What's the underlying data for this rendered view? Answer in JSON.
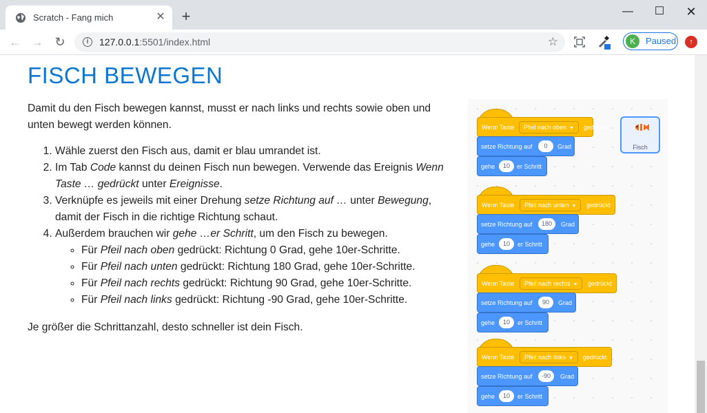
{
  "browser": {
    "tab_title": "Scratch - Fang mich",
    "url_host": "127.0.0.1",
    "url_rest": ":5501/index.html",
    "profile_initial": "K",
    "profile_label": "Paused"
  },
  "page": {
    "title": "FISCH BEWEGEN",
    "intro": "Damit du den Fisch bewegen kannst, musst er nach links und rechts sowie oben und unten bewegt werden können.",
    "steps": {
      "s1": "Wähle zuerst den Fisch aus, damit er blau umrandet ist.",
      "s2_a": "Im Tab ",
      "s2_b": "Code",
      "s2_c": " kannst du deinen Fisch nun bewegen. Verwende das Ereignis ",
      "s2_d": "Wenn Taste … gedrückt",
      "s2_e": " unter ",
      "s2_f": "Ereignisse",
      "s2_g": ".",
      "s3_a": "Verknüpfe es jeweils mit einer Drehung ",
      "s3_b": "setze Richtung auf …",
      "s3_c": " unter ",
      "s3_d": "Bewegung",
      "s3_e": ", damit der Fisch in die richtige Richtung schaut.",
      "s4_a": "Außerdem brauchen wir ",
      "s4_b": "gehe …er Schritt",
      "s4_c": ", um den Fisch zu bewegen.",
      "sub": [
        {
          "pre": "Für ",
          "em": "Pfeil nach oben",
          "post": " gedrückt: Richtung 0 Grad, gehe 10er-Schritte."
        },
        {
          "pre": "Für ",
          "em": "Pfeil nach unten",
          "post": " gedrückt: Richtung 180 Grad, gehe 10er-Schritte."
        },
        {
          "pre": "Für ",
          "em": "Pfeil nach rechts",
          "post": " gedrückt: Richtung 90 Grad, gehe 10er-Schritte."
        },
        {
          "pre": "Für ",
          "em": "Pfeil nach links",
          "post": " gedrückt: Richtung -90 Grad, gehe 10er-Schritte."
        }
      ]
    },
    "outro": "Je größer die Schrittanzahl, desto schneller ist dein Fisch."
  },
  "scratch": {
    "sprite_name": "Fisch",
    "hat_prefix": "Wenn Taste",
    "hat_suffix": "gedrückt",
    "dir_label": "setze Richtung auf",
    "dir_unit": "Grad",
    "move_label": "gehe",
    "move_suffix": "er Schritt",
    "scripts": [
      {
        "key": "Pfeil nach oben",
        "direction": "0",
        "steps": "10"
      },
      {
        "key": "Pfeil nach unten",
        "direction": "180",
        "steps": "10"
      },
      {
        "key": "Pfeil nach rechts",
        "direction": "90",
        "steps": "10"
      },
      {
        "key": "Pfeil nach links",
        "direction": "-90",
        "steps": "10"
      }
    ]
  }
}
